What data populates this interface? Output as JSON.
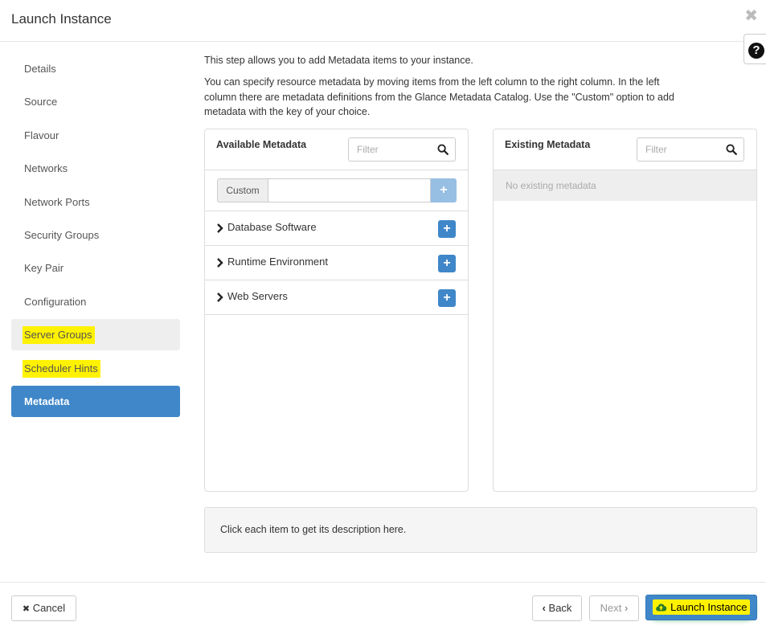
{
  "modal": {
    "title": "Launch Instance",
    "close_glyph": "✖",
    "help_glyph": "?"
  },
  "nav": {
    "items": [
      {
        "label": "Details"
      },
      {
        "label": "Source"
      },
      {
        "label": "Flavour"
      },
      {
        "label": "Networks"
      },
      {
        "label": "Network Ports"
      },
      {
        "label": "Security Groups"
      },
      {
        "label": "Key Pair"
      },
      {
        "label": "Configuration"
      },
      {
        "label": "Server Groups"
      },
      {
        "label": "Scheduler Hints"
      },
      {
        "label": "Metadata"
      }
    ]
  },
  "content": {
    "intro_line1": "This step allows you to add Metadata items to your instance.",
    "intro_line2": "You can specify resource metadata by moving items from the left column to the right column. In the left column there are metadata definitions from the Glance Metadata Catalog. Use the \"Custom\" option to add metadata with the key of your choice."
  },
  "available": {
    "title": "Available Metadata",
    "filter_placeholder": "Filter",
    "custom_label": "Custom",
    "custom_value": "",
    "add_glyph": "+",
    "items": [
      {
        "label": "Database Software"
      },
      {
        "label": "Runtime Environment"
      },
      {
        "label": "Web Servers"
      }
    ]
  },
  "existing": {
    "title": "Existing Metadata",
    "filter_placeholder": "Filter",
    "empty_text": "No existing metadata"
  },
  "description": {
    "text": "Click each item to get its description here."
  },
  "footer": {
    "cancel_glyph": "✖",
    "cancel_label": "Cancel",
    "back_glyph": "‹",
    "back_label": "Back",
    "next_label": "Next",
    "next_glyph": "›",
    "launch_label": "Launch Instance"
  },
  "colors": {
    "accent": "#3f87c9",
    "highlight": "#fff200"
  }
}
